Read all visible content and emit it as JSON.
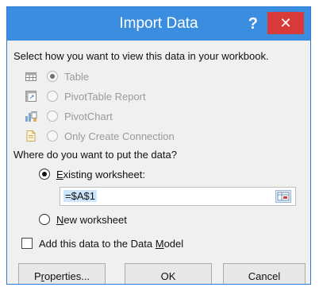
{
  "dialog": {
    "title": "Import Data",
    "help_label": "?",
    "close_label": "✕"
  },
  "view_prompt": "Select how you want to view this data in your workbook.",
  "view_options": [
    {
      "label": "Table",
      "selected": true,
      "enabled": false,
      "icon": "table-icon"
    },
    {
      "label": "PivotTable Report",
      "selected": false,
      "enabled": false,
      "icon": "pivottable-icon"
    },
    {
      "label": "PivotChart",
      "selected": false,
      "enabled": false,
      "icon": "pivotchart-icon"
    },
    {
      "label": "Only Create Connection",
      "selected": false,
      "enabled": false,
      "icon": "connection-icon"
    }
  ],
  "location_prompt": "Where do you want to put the data?",
  "existing_worksheet": {
    "label_pre": "",
    "label_key": "E",
    "label_post": "xisting worksheet:",
    "selected": true
  },
  "reference": {
    "value": "=$A$1",
    "collapse_icon": "range-select-icon"
  },
  "new_worksheet": {
    "label_key": "N",
    "label_post": "ew worksheet",
    "selected": false
  },
  "data_model": {
    "label_pre": "Add this data to the Data ",
    "label_key": "M",
    "label_post": "odel",
    "checked": false
  },
  "buttons": {
    "properties_pre": "P",
    "properties_key": "r",
    "properties_post": "operties...",
    "ok": "OK",
    "cancel": "Cancel"
  },
  "colors": {
    "titlebar": "#3b8de0",
    "close": "#d73a37",
    "background": "#f0f0f0"
  }
}
